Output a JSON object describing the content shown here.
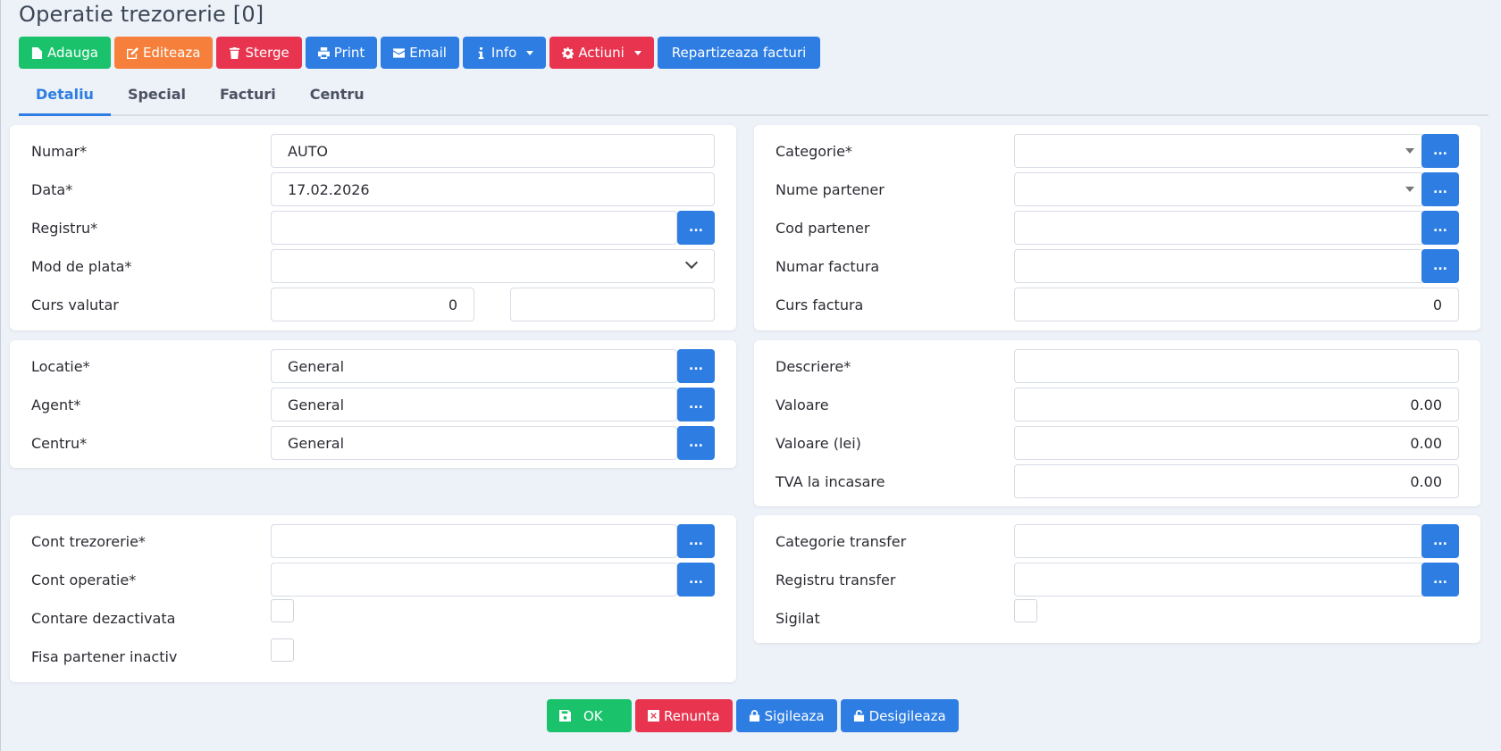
{
  "title": "Operatie trezorerie [0]",
  "toolbar": {
    "add": "Adauga",
    "edit": "Editeaza",
    "delete": "Sterge",
    "print": "Print",
    "email": "Email",
    "info": "Info",
    "actions": "Actiuni",
    "distribute": "Repartizeaza facturi"
  },
  "tabs": [
    "Detaliu",
    "Special",
    "Facturi",
    "Centru"
  ],
  "left_top": {
    "numar_label": "Numar*",
    "numar_value": "AUTO",
    "data_label": "Data*",
    "data_value": "17.02.2026",
    "registru_label": "Registru*",
    "registru_value": "",
    "mod_plata_label": "Mod de plata*",
    "mod_plata_value": "",
    "curs_label": "Curs valutar",
    "curs_value": "0",
    "curs_value2": ""
  },
  "left_mid": {
    "locatie_label": "Locatie*",
    "locatie_value": "General",
    "agent_label": "Agent*",
    "agent_value": "General",
    "centru_label": "Centru*",
    "centru_value": "General"
  },
  "left_bottom": {
    "cont_trez_label": "Cont trezorerie*",
    "cont_op_label": "Cont operatie*",
    "contare_label": "Contare dezactivata",
    "fisa_label": "Fisa partener inactiv"
  },
  "right_top": {
    "categorie_label": "Categorie*",
    "nume_partener_label": "Nume partener",
    "cod_partener_label": "Cod partener",
    "numar_factura_label": "Numar factura",
    "curs_factura_label": "Curs factura",
    "curs_factura_value": "0"
  },
  "right_mid": {
    "descriere_label": "Descriere*",
    "valoare_label": "Valoare",
    "valoare_value": "0.00",
    "valoare_lei_label": "Valoare (lei)",
    "valoare_lei_value": "0.00",
    "tva_label": "TVA la incasare",
    "tva_value": "0.00"
  },
  "right_bottom": {
    "cat_transfer_label": "Categorie transfer",
    "reg_transfer_label": "Registru transfer",
    "sigilat_label": "Sigilat"
  },
  "lookup_label": "...",
  "footer": {
    "ok": "OK",
    "cancel": "Renunta",
    "seal": "Sigileaza",
    "unseal": "Desigileaza"
  }
}
